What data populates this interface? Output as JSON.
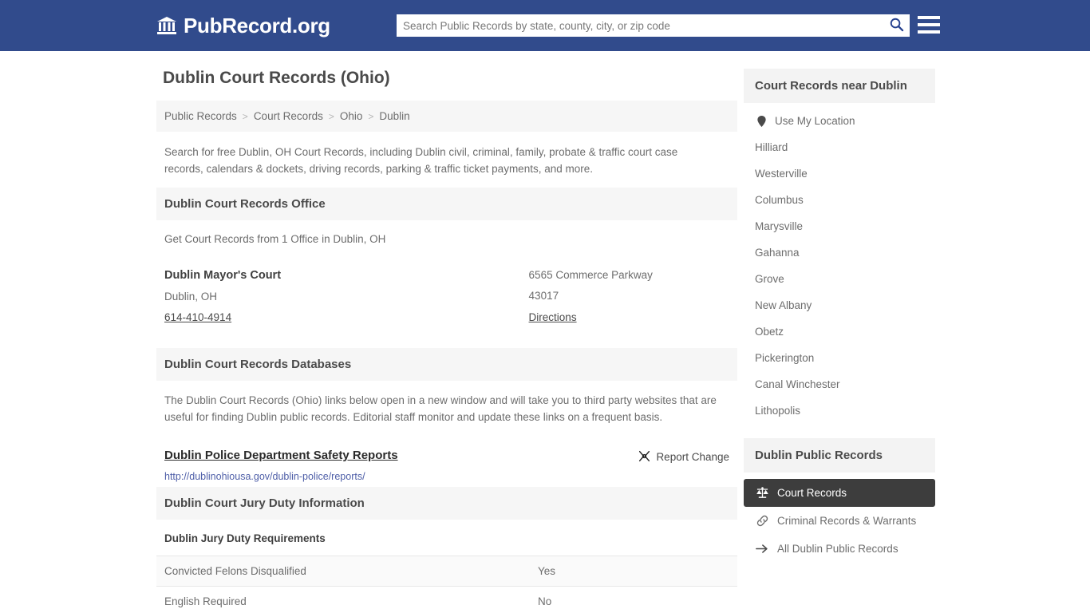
{
  "header": {
    "logo_icon": "bank-building-icon",
    "brand": "PubRecord.org",
    "search_placeholder": "Search Public Records by state, county, city, or zip code",
    "search_value": "",
    "search_icon": "search-icon",
    "menu_icon": "hamburger-menu-icon",
    "navy": "#314b8c"
  },
  "page_title": "Dublin Court Records (Ohio)",
  "breadcrumb": {
    "items": [
      "Public Records",
      "Court Records",
      "Ohio",
      "Dublin"
    ],
    "separator": ">"
  },
  "intro": "Search for free Dublin, OH Court Records, including Dublin civil, criminal, family, probate & traffic court case records, calendars & dockets, driving records, parking & traffic ticket payments, and more.",
  "office_section": {
    "heading": "Dublin Court Records Office",
    "lead": "Get Court Records from 1 Office in Dublin, OH",
    "office": {
      "name": "Dublin Mayor's Court",
      "city_state": "Dublin, OH",
      "phone": "614-410-4914",
      "street": "6565 Commerce Parkway",
      "zip": "43017",
      "directions_label": "Directions"
    }
  },
  "databases_section": {
    "heading": "Dublin Court Records Databases",
    "paragraph": "The Dublin Court Records (Ohio) links below open in a new window and will take you to third party websites that are useful for finding Dublin public records. Editorial staff monitor and update these links on a frequent basis.",
    "link_title": "Dublin Police Department Safety Reports",
    "link_url": "http://dublinohiousa.gov/dublin-police/reports/",
    "report_change_label": "Report Change",
    "report_change_icon": "broken-link-icon",
    "url_color": "#4f5fa8"
  },
  "jury_section": {
    "heading": "Dublin Court Jury Duty Information",
    "subheading": "Dublin Jury Duty Requirements",
    "rows": [
      {
        "label": "Convicted Felons Disqualified",
        "value": "Yes"
      },
      {
        "label": "English Required",
        "value": "No"
      }
    ]
  },
  "sidebar": {
    "near_heading": "Court Records near Dublin",
    "use_my_location": {
      "label": "Use My Location",
      "icon": "map-pin-icon"
    },
    "cities": [
      "Hilliard",
      "Westerville",
      "Columbus",
      "Marysville",
      "Gahanna",
      "Grove",
      "New Albany",
      "Obetz",
      "Pickerington",
      "Canal Winchester",
      "Lithopolis"
    ],
    "public_records_heading": "Dublin Public Records",
    "public_records": [
      {
        "label": "Court Records",
        "icon": "scales-of-justice-icon",
        "active": true
      },
      {
        "label": "Criminal Records & Warrants",
        "icon": "link-chain-icon",
        "active": false
      },
      {
        "label": "All Dublin Public Records",
        "icon": "arrow-right-icon",
        "active": false
      }
    ],
    "active_bg": "#3d3d3d"
  }
}
